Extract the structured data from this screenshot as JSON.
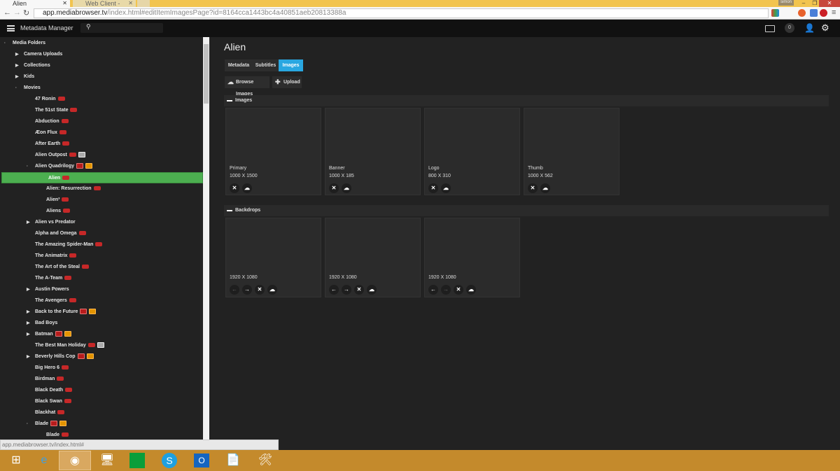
{
  "browser": {
    "tabs": [
      {
        "title": "Alien"
      },
      {
        "title": "Web Client - Emby S"
      }
    ],
    "url_host": "app.mediabrowser.tv",
    "url_path": "/index.html#editItemImagesPage?id=8164cca1443bc4a40851aeb20813388a",
    "user": "simon",
    "status_url": "app.mediabrowser.tv/index.html#"
  },
  "app": {
    "title": "Metadata Manager",
    "notifications": "0"
  },
  "tree": [
    {
      "label": "Media Folders",
      "level": 0,
      "exp": "dot",
      "icons": []
    },
    {
      "label": "Camera Uploads",
      "level": 1,
      "exp": "arrow",
      "icons": []
    },
    {
      "label": "Collections",
      "level": 1,
      "exp": "arrow",
      "icons": []
    },
    {
      "label": "Kids",
      "level": 1,
      "exp": "arrow",
      "icons": []
    },
    {
      "label": "Movies",
      "level": 1,
      "exp": "dot",
      "icons": []
    },
    {
      "label": "47 Ronin",
      "level": 2,
      "icons": [
        "movie"
      ]
    },
    {
      "label": "The 51st State",
      "level": 2,
      "icons": [
        "movie"
      ]
    },
    {
      "label": "Abduction",
      "level": 2,
      "icons": [
        "movie"
      ]
    },
    {
      "label": "Æon Flux",
      "level": 2,
      "icons": [
        "movie"
      ]
    },
    {
      "label": "After Earth",
      "level": 2,
      "icons": [
        "movie"
      ]
    },
    {
      "label": "Alien Outpost",
      "level": 2,
      "icons": [
        "movie",
        "img-gray"
      ]
    },
    {
      "label": "Alien Quadrilogy",
      "level": 2,
      "exp": "dot",
      "icons": [
        "img-red",
        "img-orange"
      ]
    },
    {
      "label": "Alien",
      "level": 3,
      "icons": [
        "movie"
      ],
      "selected": true
    },
    {
      "label": "Alien: Resurrection",
      "level": 3,
      "icons": [
        "movie"
      ]
    },
    {
      "label": "Alien³",
      "level": 3,
      "icons": [
        "movie"
      ]
    },
    {
      "label": "Aliens",
      "level": 3,
      "icons": [
        "movie"
      ]
    },
    {
      "label": "Alien vs Predator",
      "level": 2,
      "exp": "arrow",
      "icons": []
    },
    {
      "label": "Alpha and Omega",
      "level": 2,
      "icons": [
        "movie"
      ]
    },
    {
      "label": "The Amazing Spider-Man",
      "level": 2,
      "icons": [
        "movie"
      ]
    },
    {
      "label": "The Animatrix",
      "level": 2,
      "icons": [
        "movie"
      ]
    },
    {
      "label": "The Art of the Steal",
      "level": 2,
      "icons": [
        "movie"
      ]
    },
    {
      "label": "The A-Team",
      "level": 2,
      "icons": [
        "movie"
      ]
    },
    {
      "label": "Austin Powers",
      "level": 2,
      "exp": "arrow",
      "icons": []
    },
    {
      "label": "The Avengers",
      "level": 2,
      "icons": [
        "movie"
      ]
    },
    {
      "label": "Back to the Future",
      "level": 2,
      "exp": "arrow",
      "icons": [
        "img-red",
        "img-orange"
      ]
    },
    {
      "label": "Bad Boys",
      "level": 2,
      "exp": "arrow",
      "icons": []
    },
    {
      "label": "Batman",
      "level": 2,
      "exp": "arrow",
      "icons": [
        "img-red",
        "img-orange"
      ]
    },
    {
      "label": "The Best Man Holiday",
      "level": 2,
      "icons": [
        "movie",
        "img-gray"
      ]
    },
    {
      "label": "Beverly Hills Cop",
      "level": 2,
      "exp": "arrow",
      "icons": [
        "img-red",
        "img-orange"
      ]
    },
    {
      "label": "Big Hero 6",
      "level": 2,
      "icons": [
        "movie"
      ]
    },
    {
      "label": "Birdman",
      "level": 2,
      "icons": [
        "movie"
      ]
    },
    {
      "label": "Black Death",
      "level": 2,
      "icons": [
        "movie"
      ]
    },
    {
      "label": "Black Swan",
      "level": 2,
      "icons": [
        "movie"
      ]
    },
    {
      "label": "Blackhat",
      "level": 2,
      "icons": [
        "movie"
      ]
    },
    {
      "label": "Blade",
      "level": 2,
      "exp": "dot",
      "icons": [
        "img-red",
        "img-orange"
      ]
    },
    {
      "label": "Blade",
      "level": 3,
      "icons": [
        "movie"
      ]
    }
  ],
  "main": {
    "title": "Alien",
    "tabs": [
      "Metadata",
      "Subtitles",
      "Images"
    ],
    "active_tab": "Images",
    "browse_label": "Browse Images",
    "upload_label": "Upload",
    "images_section": "Images",
    "images": [
      {
        "type": "Primary",
        "size": "1000 X 1500"
      },
      {
        "type": "Banner",
        "size": "1000 X 185"
      },
      {
        "type": "Logo",
        "size": "800 X 310"
      },
      {
        "type": "Thumb",
        "size": "1000 X 562"
      }
    ],
    "backdrops_section": "Backdrops",
    "backdrops": [
      {
        "size": "1920 X 1080",
        "left": false,
        "right": true
      },
      {
        "size": "1920 X 1080",
        "left": true,
        "right": true
      },
      {
        "size": "1920 X 1080",
        "left": true,
        "right": false
      }
    ]
  },
  "colors": {
    "accent": "#29a7e1",
    "selected": "#4caf50",
    "movie": "#c62828"
  }
}
